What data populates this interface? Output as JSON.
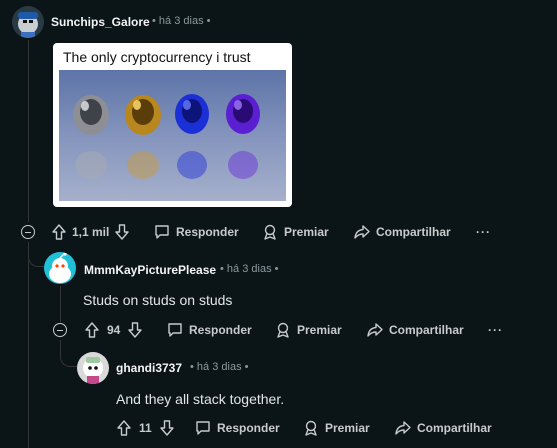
{
  "comments": [
    {
      "username": "Sunchips_Galore",
      "time": "há 3 dias",
      "image_caption": "The only cryptocurrency i trust",
      "votes": "1,1 mil",
      "reply_label": "Responder",
      "award_label": "Premiar",
      "share_label": "Compartilhar",
      "more_label": "···"
    },
    {
      "username": "MmmKayPicturePlease",
      "time": "há 3 dias",
      "text": "Studs on studs on studs",
      "votes": "94",
      "reply_label": "Responder",
      "award_label": "Premiar",
      "share_label": "Compartilhar",
      "more_label": "···"
    },
    {
      "username": "ghandi3737",
      "time": "há 3 dias",
      "text": "And they all stack together.",
      "votes": "11",
      "reply_label": "Responder",
      "award_label": "Premiar",
      "share_label": "Compartilhar"
    }
  ],
  "meta_separator": "•",
  "colors": {
    "background": "#0b1416",
    "thread_line": "#343536",
    "muted_text": "#8a9a9e",
    "username": "#f2f4f5"
  }
}
